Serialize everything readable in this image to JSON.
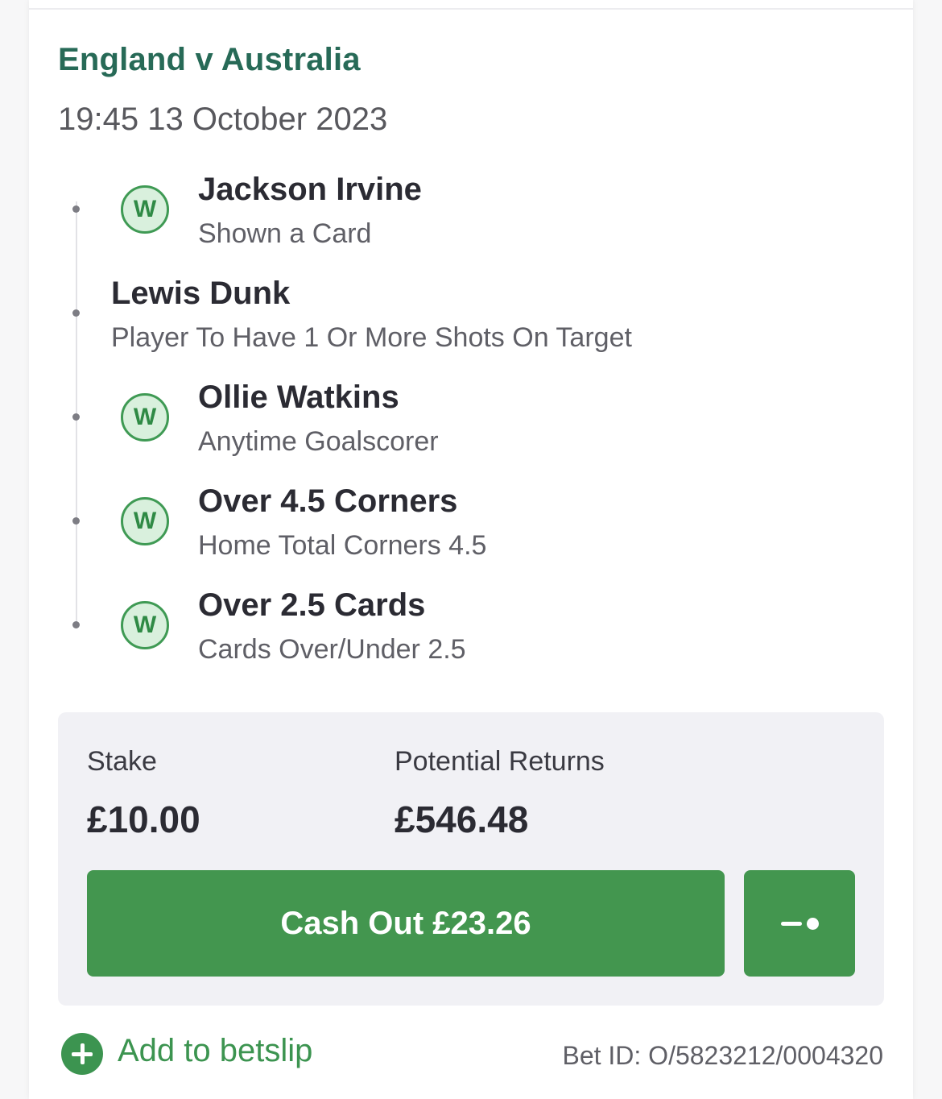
{
  "event": {
    "title": "England v Australia",
    "datetime": "19:45 13 October 2023"
  },
  "selections": [
    {
      "name": "Jackson Irvine",
      "market": "Shown a Card",
      "status": "W",
      "won": true
    },
    {
      "name": "Lewis Dunk",
      "market": "Player To Have 1 Or More Shots On Target",
      "status": "",
      "won": false
    },
    {
      "name": "Ollie Watkins",
      "market": "Anytime Goalscorer",
      "status": "W",
      "won": true
    },
    {
      "name": "Over 4.5 Corners",
      "market": "Home Total Corners 4.5",
      "status": "W",
      "won": true
    },
    {
      "name": "Over 2.5 Cards",
      "market": "Cards Over/Under 2.5",
      "status": "W",
      "won": true
    }
  ],
  "summary": {
    "stake_label": "Stake",
    "stake_value": "£10.00",
    "returns_label": "Potential Returns",
    "returns_value": "£546.48",
    "cashout_label": "Cash Out £23.26"
  },
  "footer": {
    "add_label": "Add to betslip",
    "bet_id": "Bet ID: O/5823212/0004320"
  },
  "colors": {
    "title_green": "#276a57",
    "button_green": "#43964f",
    "badge_bg": "#d9f0dd"
  },
  "icons": {
    "win_badge": "win-badge-icon",
    "slider": "partial-cashout-slider-icon",
    "add": "plus-circle-icon"
  }
}
